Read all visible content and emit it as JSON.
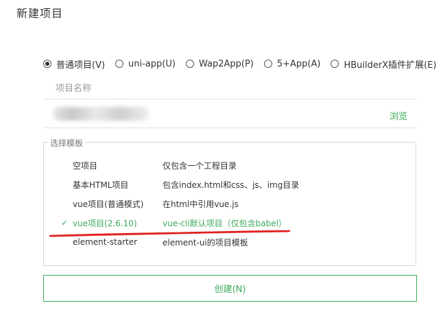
{
  "dialog": {
    "title": "新建项目"
  },
  "project_types": [
    {
      "label": "普通项目(V)",
      "checked": true
    },
    {
      "label": "uni-app(U)",
      "checked": false
    },
    {
      "label": "Wap2App(P)",
      "checked": false
    },
    {
      "label": "5+App(A)",
      "checked": false
    },
    {
      "label": "HBuilderX插件扩展(E)",
      "checked": false
    }
  ],
  "project_name": {
    "placeholder": "项目名称",
    "value": ""
  },
  "location": {
    "browse_label": "浏览"
  },
  "templates": {
    "legend": "选择模板",
    "selected_index": 3,
    "check_icon": "✓",
    "items": [
      {
        "name": "空项目",
        "description": "仅包含一个工程目录"
      },
      {
        "name": "基本HTML项目",
        "description": "包含index.html和css、js、img目录"
      },
      {
        "name": "vue项目(普通模式)",
        "description": "在html中引用vue.js"
      },
      {
        "name": "vue项目(2.6.10)",
        "description": "vue-cli默认项目（仅包含babel）"
      },
      {
        "name": "element-starter",
        "description": "element-ui的项目模板"
      }
    ]
  },
  "actions": {
    "create_label": "创建(N)"
  },
  "colors": {
    "accent": "#3caa5a",
    "annotation": "#e02020"
  }
}
